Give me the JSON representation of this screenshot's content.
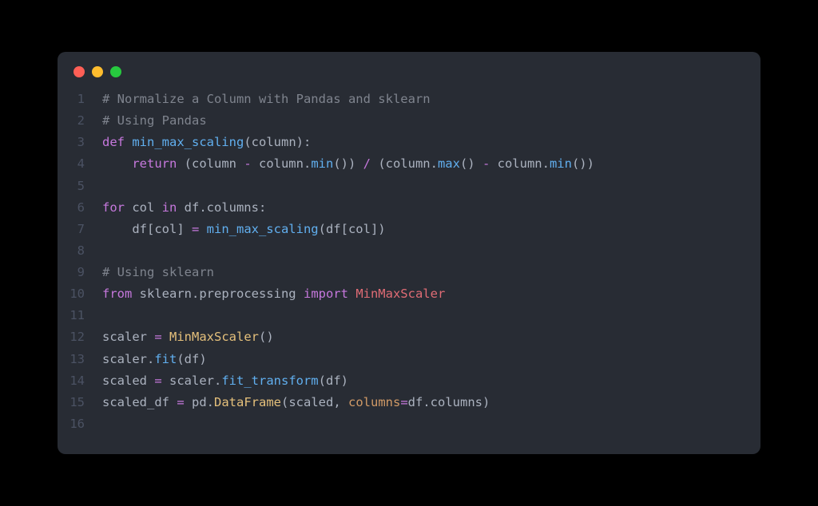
{
  "window": {
    "traffic_colors": {
      "close": "#ff5f56",
      "minimize": "#ffbd2e",
      "zoom": "#27c93f"
    }
  },
  "code": {
    "lines": [
      {
        "n": "1",
        "tokens": [
          {
            "t": "# Normalize a Column with Pandas and sklearn",
            "c": "tok-comment"
          }
        ]
      },
      {
        "n": "2",
        "tokens": [
          {
            "t": "# Using Pandas",
            "c": "tok-comment"
          }
        ]
      },
      {
        "n": "3",
        "tokens": [
          {
            "t": "def ",
            "c": "tok-kw"
          },
          {
            "t": "min_max_scaling",
            "c": "tok-fn"
          },
          {
            "t": "(",
            "c": "tok-punct"
          },
          {
            "t": "column",
            "c": "tok-param"
          },
          {
            "t": "):",
            "c": "tok-punct"
          }
        ]
      },
      {
        "n": "4",
        "tokens": [
          {
            "t": "    ",
            "c": "tok-punct"
          },
          {
            "t": "return ",
            "c": "tok-kw"
          },
          {
            "t": "(column ",
            "c": "tok-var"
          },
          {
            "t": "- ",
            "c": "tok-op"
          },
          {
            "t": "column.",
            "c": "tok-var"
          },
          {
            "t": "min",
            "c": "tok-fn"
          },
          {
            "t": "()) ",
            "c": "tok-punct"
          },
          {
            "t": "/ ",
            "c": "tok-op"
          },
          {
            "t": "(column.",
            "c": "tok-var"
          },
          {
            "t": "max",
            "c": "tok-fn"
          },
          {
            "t": "() ",
            "c": "tok-punct"
          },
          {
            "t": "- ",
            "c": "tok-op"
          },
          {
            "t": "column.",
            "c": "tok-var"
          },
          {
            "t": "min",
            "c": "tok-fn"
          },
          {
            "t": "())",
            "c": "tok-punct"
          }
        ]
      },
      {
        "n": "5",
        "tokens": []
      },
      {
        "n": "6",
        "tokens": [
          {
            "t": "for ",
            "c": "tok-kw"
          },
          {
            "t": "col ",
            "c": "tok-var"
          },
          {
            "t": "in ",
            "c": "tok-kw"
          },
          {
            "t": "df.columns:",
            "c": "tok-var"
          }
        ]
      },
      {
        "n": "7",
        "tokens": [
          {
            "t": "    df[col] ",
            "c": "tok-var"
          },
          {
            "t": "= ",
            "c": "tok-op"
          },
          {
            "t": "min_max_scaling",
            "c": "tok-fn"
          },
          {
            "t": "(df[col])",
            "c": "tok-var"
          }
        ]
      },
      {
        "n": "8",
        "tokens": []
      },
      {
        "n": "9",
        "tokens": [
          {
            "t": "# Using sklearn",
            "c": "tok-comment"
          }
        ]
      },
      {
        "n": "10",
        "tokens": [
          {
            "t": "from ",
            "c": "tok-kw"
          },
          {
            "t": "sklearn.preprocessing ",
            "c": "tok-var"
          },
          {
            "t": "import ",
            "c": "tok-kw"
          },
          {
            "t": "MinMaxScaler",
            "c": "tok-def"
          }
        ]
      },
      {
        "n": "11",
        "tokens": []
      },
      {
        "n": "12",
        "tokens": [
          {
            "t": "scaler ",
            "c": "tok-var"
          },
          {
            "t": "= ",
            "c": "tok-op"
          },
          {
            "t": "MinMaxScaler",
            "c": "tok-name"
          },
          {
            "t": "()",
            "c": "tok-punct"
          }
        ]
      },
      {
        "n": "13",
        "tokens": [
          {
            "t": "scaler.",
            "c": "tok-var"
          },
          {
            "t": "fit",
            "c": "tok-fn"
          },
          {
            "t": "(df)",
            "c": "tok-var"
          }
        ]
      },
      {
        "n": "14",
        "tokens": [
          {
            "t": "scaled ",
            "c": "tok-var"
          },
          {
            "t": "= ",
            "c": "tok-op"
          },
          {
            "t": "scaler.",
            "c": "tok-var"
          },
          {
            "t": "fit_transform",
            "c": "tok-fn"
          },
          {
            "t": "(df)",
            "c": "tok-var"
          }
        ]
      },
      {
        "n": "15",
        "tokens": [
          {
            "t": "scaled_df ",
            "c": "tok-var"
          },
          {
            "t": "= ",
            "c": "tok-op"
          },
          {
            "t": "pd.",
            "c": "tok-var"
          },
          {
            "t": "DataFrame",
            "c": "tok-name"
          },
          {
            "t": "(scaled, ",
            "c": "tok-var"
          },
          {
            "t": "columns",
            "c": "tok-kwarg"
          },
          {
            "t": "=",
            "c": "tok-op"
          },
          {
            "t": "df.columns)",
            "c": "tok-var"
          }
        ]
      },
      {
        "n": "16",
        "tokens": []
      }
    ]
  }
}
